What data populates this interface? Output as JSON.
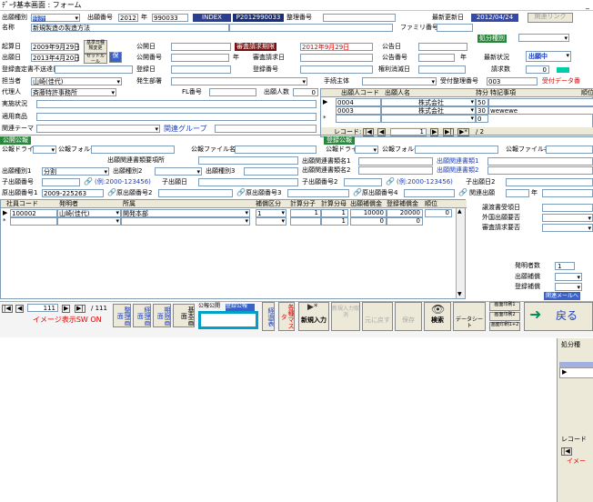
{
  "window": {
    "title": "ﾃﾞｰﾀ基本画面 : フォーム",
    "close": "_"
  },
  "r1": {
    "kind_lbl": "出願種別",
    "kind_val": "特許",
    "no_lbl": "出願番号",
    "year": "2012",
    "year_lbl": "年",
    "no": "990033",
    "no_btn": "INDEX",
    "no_val": "P2012990033",
    "seiri_lbl": "整理番号",
    "upd_lbl": "最新更新日",
    "upd_val": "2012/04/24",
    "link": "関連リンク"
  },
  "r2": {
    "name_lbl": "名称",
    "name_val": "新規製造の製造方法",
    "family_lbl": "ファミリ番号",
    "shobun_lbl": "処分種別"
  },
  "r3": {
    "kisan_lbl": "起算日",
    "kisan_val": "2009年9月29日",
    "btn1": "基準日種類変更",
    "kokai_lbl": "公開日",
    "shinsa_lbl": "審査請求期限",
    "shinsa_val": "2012年9月29日",
    "koku_lbl": "公告日"
  },
  "r4": {
    "shutsugan_lbl": "出願日",
    "shutsugan_val": "2013年4月20日",
    "btn2": "セットルール",
    "btn3": "保",
    "kokai_no_lbl": "公開番号",
    "nen": "年",
    "seikyu_lbl": "審査請求日",
    "kokoku_no_lbl": "公告番号",
    "nen2": "年",
    "saishin_lbl": "最新状況",
    "saishin_val": "出願中"
  },
  "r5": {
    "toroku_lbl": "登録査定書不送達日",
    "toroku_day_lbl": "登録日",
    "toroku_no_lbl": "登録番号",
    "kenri_lbl": "権利消滅日",
    "seikyu_lbl": "請求数",
    "seikyu_val": "0"
  },
  "r6": {
    "tanto_lbl": "担当者",
    "tanto_val": "山崎(佳代)",
    "hassei_lbl": "発生部署",
    "tetsuzuki_lbl": "手続主体",
    "uketsuke_lbl": "受付整理番号",
    "uketsuke_val": "003",
    "uketsuke_tag": "受付データ番"
  },
  "r7": {
    "dairi_lbl": "代理人",
    "dairi_val": "斉藤特許事務所",
    "fl_lbl": "FL番号",
    "shutsugan_nin_lbl": "出願人数",
    "shutsugan_nin_val": "0"
  },
  "r8": {
    "jisshi_lbl": "実施状況"
  },
  "r9": {
    "tekiyo_lbl": "適用商品"
  },
  "r10": {
    "kanren_lbl": "関連テーマ",
    "group_lbl": "関連グループ"
  },
  "applicants": {
    "headers": [
      "出願人コード",
      "出願人名",
      "持分",
      "特記事項",
      "順位"
    ],
    "rows": [
      [
        "0004",
        "株式会社",
        "50",
        ""
      ],
      [
        "0003",
        "株式会社",
        "30",
        "wewewe"
      ],
      [
        "",
        "",
        "0",
        ""
      ]
    ],
    "record_lbl": "レコード:",
    "record_cur": "1",
    "record_total": "/ 2"
  },
  "kokai": {
    "left_label": "公開公報",
    "left_drive": "公報ドライブ",
    "left_folder": "公報フォルダー",
    "left_file": "公報ファイル名",
    "right_label": "登録公報",
    "right_drive": "公報ドライブ",
    "right_folder": "公報フォルダー",
    "right_file": "公報ファイル名"
  },
  "rel": {
    "title": "出願関連書類要項所",
    "name1": "出願関連書類名1",
    "name2": "出願関連書類名2",
    "link1": "出願関連書類1",
    "link2": "出願関連書類2",
    "kind1_lbl": "出願種別1",
    "kind1_val": "分割",
    "kind2_lbl": "出願種別2",
    "kind3_lbl": "出願種別3",
    "child_lbl": "子出願番号",
    "eg1": "(例:2000-123456)",
    "child_day_lbl": "子出願日",
    "child2_lbl": "子出願番号2",
    "eg2": "(例:2000-123456)",
    "child2_day_lbl": "子出願日2",
    "orig1_lbl": "原出願番号1",
    "orig1_val": "2009-225263",
    "orig2_lbl": "原出願番号2",
    "orig3_lbl": "原出願番号3",
    "orig4_lbl": "原出願番号4",
    "kanren_lbl": "関連出願",
    "nen": "年"
  },
  "hatsu": {
    "headers": [
      "社員コード",
      "発明者",
      "所属",
      "補償区分",
      "計算分子",
      "計算分母",
      "出願補償金",
      "登録補償金",
      "順位"
    ],
    "rows": [
      [
        "100002",
        "山崎(佳代)",
        "開発本部",
        "1",
        "1",
        "1",
        "10000",
        "20000",
        "0"
      ],
      [
        "",
        "",
        "",
        "",
        "",
        "1",
        "0",
        "0",
        ""
      ]
    ]
  },
  "right": {
    "keisha_lbl": "譲渡書受領日",
    "gaikoku_lbl": "外国出願要否",
    "shinsa_lbl": "審査請求要否",
    "hatsumei_lbl": "発明者数",
    "hatsumei_val": "1",
    "shutsugan_hosho_lbl": "出願補償",
    "toroku_hosho_lbl": "登録補償",
    "mail_lbl": "関連メールへ"
  },
  "nav": {
    "record_lbl": "111",
    "total": "/ 111",
    "image_sw": "イメージ表示SW ON",
    "b_seiri": "整理画面",
    "b_keiri": "経理画面",
    "b_kiki": "期限画面",
    "b_kihon": "基本画面",
    "kokai_tab": "公報公開",
    "toroku_tab": "登録公報",
    "b_keika": "経過表",
    "b_kakuri": "各種マスタ",
    "b_new": "新規入力",
    "b_newcancel": "新規入力取消",
    "b_modosu": "元に戻す",
    "b_save": "保存",
    "b_search": "検索",
    "b_datasheet": "データシート",
    "print1": "画面印刷1",
    "print2": "画面印刷2",
    "print12": "画面印刷1+2",
    "back": "戻る"
  },
  "side": {
    "t": "処分種",
    "rec": "レコード",
    "img": "イメー"
  }
}
